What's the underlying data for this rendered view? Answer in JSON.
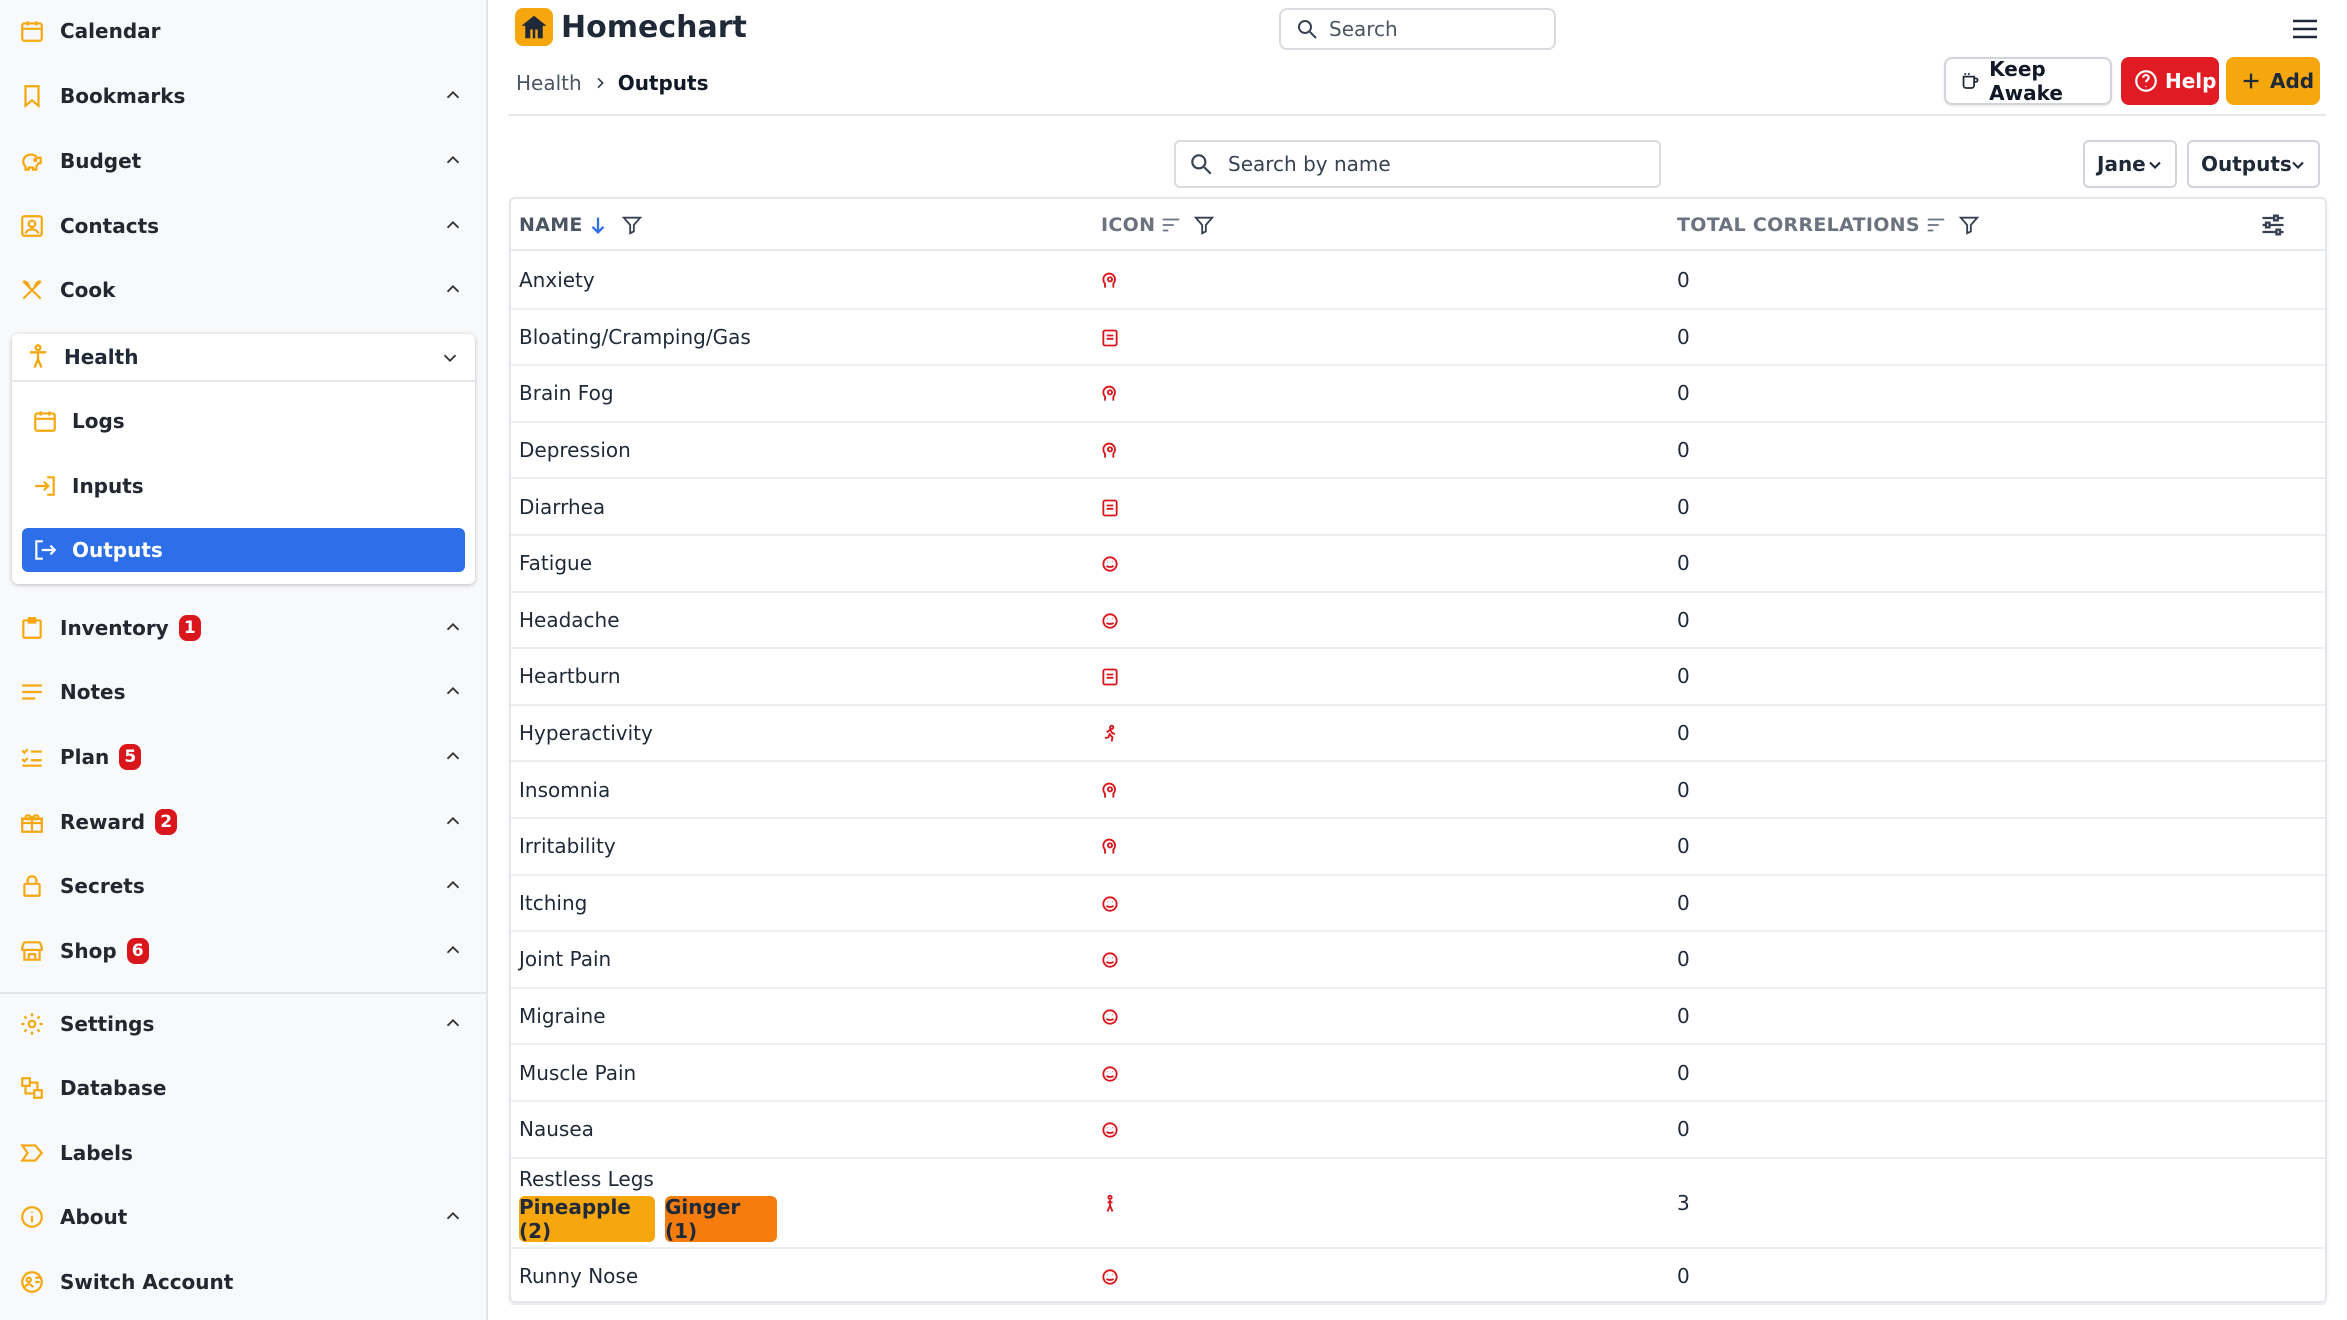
{
  "app": {
    "title": "Homechart"
  },
  "search": {
    "placeholder": "Search"
  },
  "sidebar": {
    "items": [
      {
        "label": "Calendar",
        "icon": "calendar-icon"
      },
      {
        "label": "Bookmarks",
        "icon": "bookmark-icon"
      },
      {
        "label": "Budget",
        "icon": "piggy-bank-icon"
      },
      {
        "label": "Contacts",
        "icon": "contacts-icon"
      },
      {
        "label": "Cook",
        "icon": "utensils-icon"
      },
      {
        "label": "Health",
        "icon": "person-icon"
      },
      {
        "label": "Inventory",
        "icon": "inventory-icon",
        "badge": "1"
      },
      {
        "label": "Notes",
        "icon": "notes-icon"
      },
      {
        "label": "Plan",
        "icon": "checklist-icon",
        "badge": "5"
      },
      {
        "label": "Reward",
        "icon": "gift-icon",
        "badge": "2"
      },
      {
        "label": "Secrets",
        "icon": "lock-icon"
      },
      {
        "label": "Shop",
        "icon": "store-icon",
        "badge": "6"
      },
      {
        "label": "Settings",
        "icon": "gear-icon"
      },
      {
        "label": "Database",
        "icon": "database-icon"
      },
      {
        "label": "Labels",
        "icon": "label-icon"
      },
      {
        "label": "About",
        "icon": "info-icon"
      },
      {
        "label": "Switch Account",
        "icon": "switch-account-icon"
      }
    ],
    "health_sub": [
      {
        "label": "Logs",
        "icon": "calendar-icon"
      },
      {
        "label": "Inputs",
        "icon": "input-icon"
      },
      {
        "label": "Outputs",
        "icon": "output-icon",
        "active": true
      }
    ]
  },
  "breadcrumb": {
    "parent": "Health",
    "current": "Outputs"
  },
  "toolbar": {
    "keep_awake_label": "Keep Awake",
    "help_label": "Help",
    "add_label": "Add"
  },
  "filters": {
    "name_search_placeholder": "Search by name",
    "user_select": "Jane",
    "view_select": "Outputs"
  },
  "table": {
    "columns": {
      "name": "NAME",
      "icon": "ICON",
      "total": "TOTAL CORRELATIONS"
    },
    "rows": [
      {
        "name": "Anxiety",
        "icon": "head-icon",
        "total": "0"
      },
      {
        "name": "Bloating/Cramping/Gas",
        "icon": "stomach-icon",
        "total": "0"
      },
      {
        "name": "Brain Fog",
        "icon": "head-icon",
        "total": "0"
      },
      {
        "name": "Depression",
        "icon": "head-icon",
        "total": "0"
      },
      {
        "name": "Diarrhea",
        "icon": "stomach-icon",
        "total": "0"
      },
      {
        "name": "Fatigue",
        "icon": "face-icon",
        "total": "0"
      },
      {
        "name": "Headache",
        "icon": "face-icon",
        "total": "0"
      },
      {
        "name": "Heartburn",
        "icon": "stomach-icon",
        "total": "0"
      },
      {
        "name": "Hyperactivity",
        "icon": "running-icon",
        "total": "0"
      },
      {
        "name": "Insomnia",
        "icon": "head-icon",
        "total": "0"
      },
      {
        "name": "Irritability",
        "icon": "head-icon",
        "total": "0"
      },
      {
        "name": "Itching",
        "icon": "face-icon",
        "total": "0"
      },
      {
        "name": "Joint Pain",
        "icon": "face-icon",
        "total": "0"
      },
      {
        "name": "Migraine",
        "icon": "face-icon",
        "total": "0"
      },
      {
        "name": "Muscle Pain",
        "icon": "face-icon",
        "total": "0"
      },
      {
        "name": "Nausea",
        "icon": "face-icon",
        "total": "0"
      },
      {
        "name": "Restless Legs",
        "icon": "walking-icon",
        "total": "3",
        "tags": [
          {
            "label": "Pineapple (2)",
            "color": "#f5a70d"
          },
          {
            "label": "Ginger (1)",
            "color": "#f57c0d"
          }
        ]
      },
      {
        "name": "Runny Nose",
        "icon": "face-icon",
        "total": "0"
      }
    ]
  },
  "colors": {
    "accent": "#f5a70d",
    "active": "#2d6fe8",
    "danger": "#e01b24",
    "icon_red": "#d9161c"
  }
}
